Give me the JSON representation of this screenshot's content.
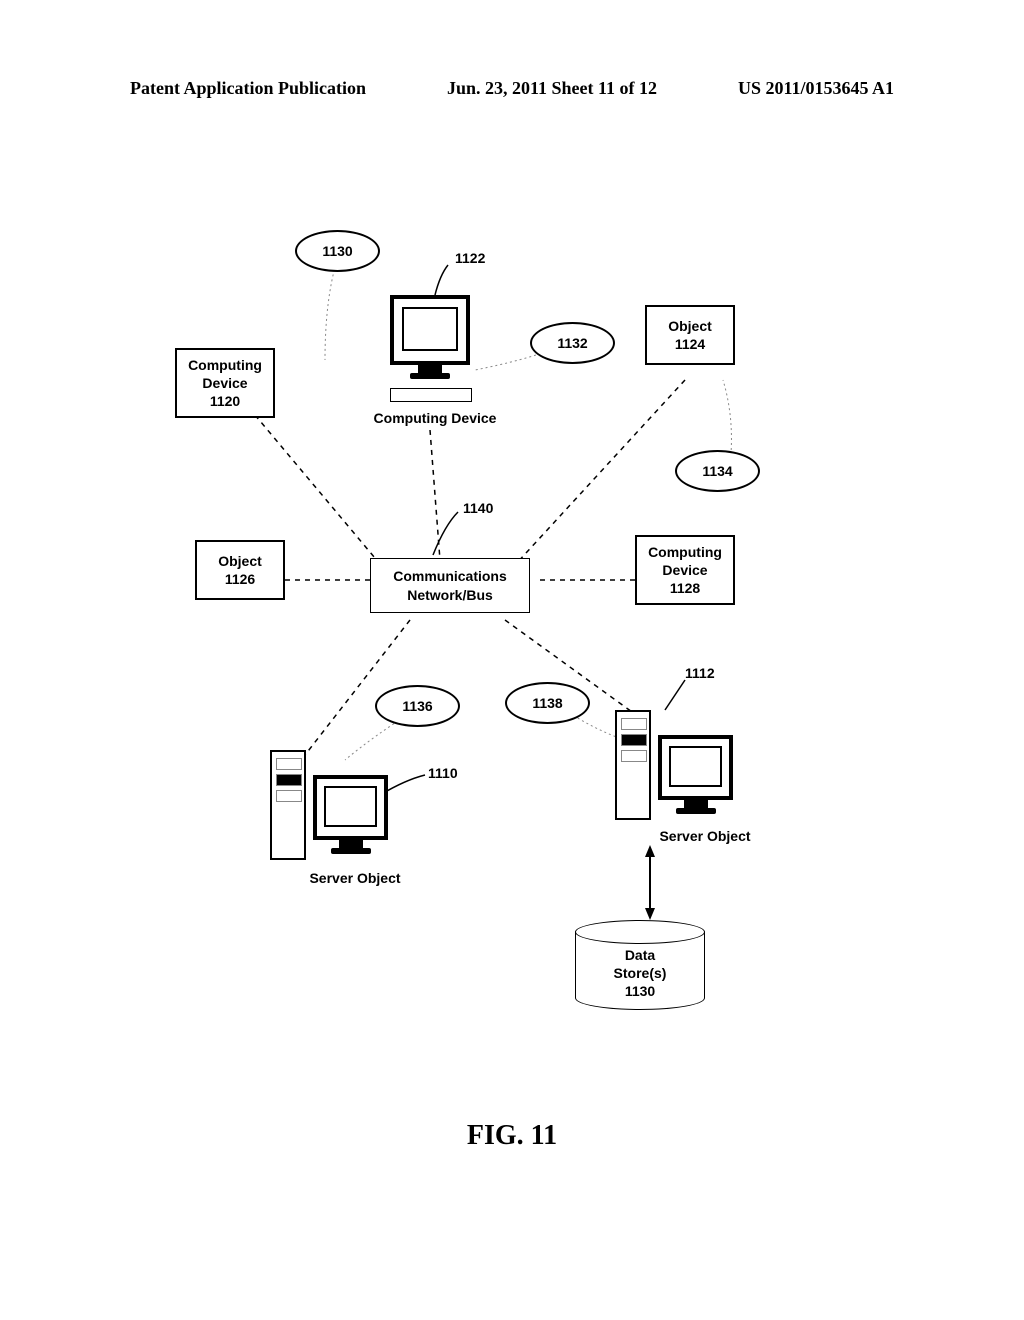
{
  "header": {
    "left": "Patent Application Publication",
    "center": "Jun. 23, 2011  Sheet 11 of 12",
    "right": "US 2011/0153645 A1"
  },
  "ellipses": {
    "e1130": "1130",
    "e1132": "1132",
    "e1134": "1134",
    "e1136": "1136",
    "e1138": "1138"
  },
  "boxes": {
    "computing_device_1120": {
      "line1": "Computing",
      "line2": "Device",
      "line3": "1120"
    },
    "object_1124": {
      "line1": "Object",
      "line2": "1124"
    },
    "object_1126": {
      "line1": "Object",
      "line2": "1126"
    },
    "computing_device_1128": {
      "line1": "Computing",
      "line2": "Device",
      "line3": "1128"
    },
    "network_bus": {
      "line1": "Communications",
      "line2": "Network/Bus"
    }
  },
  "labels": {
    "computing_device": "Computing Device",
    "server_object_left": "Server Object",
    "server_object_right": "Server Object",
    "data_store_line1": "Data",
    "data_store_line2": "Store(s)",
    "data_store_line3": "1130",
    "ref_1122": "1122",
    "ref_1140": "1140",
    "ref_1110": "1110",
    "ref_1112": "1112"
  },
  "caption": "FIG. 11"
}
